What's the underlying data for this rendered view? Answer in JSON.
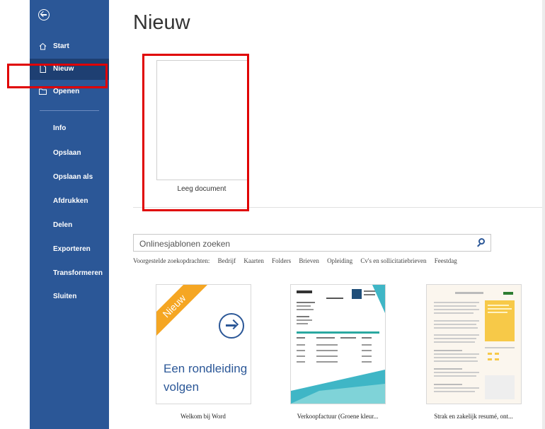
{
  "sidebar": {
    "items": [
      {
        "label": "Start",
        "icon": "home-icon"
      },
      {
        "label": "Nieuw",
        "icon": "new-document-icon",
        "active": true
      },
      {
        "label": "Openen",
        "icon": "folder-icon"
      },
      {
        "label": "Info"
      },
      {
        "label": "Opslaan"
      },
      {
        "label": "Opslaan als"
      },
      {
        "label": "Afdrukken"
      },
      {
        "label": "Delen"
      },
      {
        "label": "Exporteren"
      },
      {
        "label": "Transformeren"
      },
      {
        "label": "Sluiten"
      }
    ]
  },
  "main": {
    "title": "Nieuw",
    "blank_label": "Leeg document",
    "search": {
      "placeholder": "Onlinesjablonen zoeken"
    },
    "suggestions_label": "Voorgestelde zoekopdrachten:",
    "suggestions": [
      "Bedrijf",
      "Kaarten",
      "Folders",
      "Brieven",
      "Opleiding",
      "Cv's en sollicitatiebrieven",
      "Feestdag"
    ],
    "templates": [
      {
        "label": "Welkom bij Word",
        "ribbon": "Nieuw",
        "text_line1": "Een rondleiding",
        "text_line2": "volgen"
      },
      {
        "label": "Verkoopfactuur (Groene kleur..."
      },
      {
        "label": "Strak en zakelijk resumé, ont..."
      }
    ]
  },
  "colors": {
    "sidebar": "#2b5797",
    "highlight": "#e00000",
    "ribbon": "#f5a623"
  }
}
